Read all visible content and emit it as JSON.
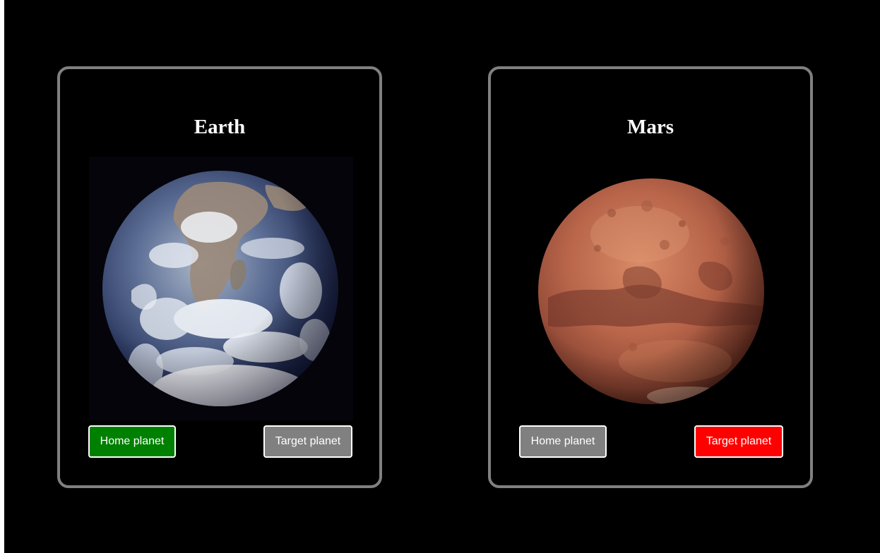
{
  "planets": [
    {
      "name": "Earth",
      "image_icon": "earth-globe-image",
      "buttons": {
        "home_label": "Home planet",
        "home_color": "#008000",
        "target_label": "Target planet",
        "target_color": "#808080"
      }
    },
    {
      "name": "Mars",
      "image_icon": "mars-globe-image",
      "buttons": {
        "home_label": "Home planet",
        "home_color": "#808080",
        "target_label": "Target planet",
        "target_color": "#ff0000"
      }
    }
  ],
  "colors": {
    "background": "#000000",
    "card_border": "#808080",
    "button_border": "#ffffff",
    "selected_home": "#008000",
    "selected_target": "#ff0000",
    "unselected": "#808080"
  }
}
